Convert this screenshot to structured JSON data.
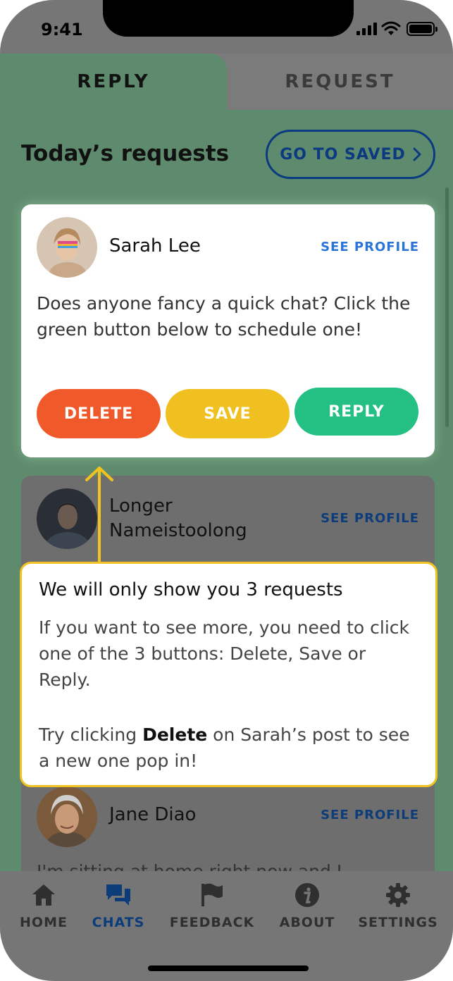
{
  "status_bar": {
    "time": "9:41"
  },
  "tabs": [
    {
      "label": "REPLY",
      "active": true
    },
    {
      "label": "REQUEST",
      "active": false
    }
  ],
  "header": {
    "title": "Today’s requests",
    "go_saved_label": "GO TO SAVED"
  },
  "cards": [
    {
      "name": "Sarah Lee",
      "see_profile": "SEE PROFILE",
      "body": "Does anyone fancy a quick chat? Click the green button below to schedule one!",
      "buttons": {
        "delete": "DELETE",
        "save": "SAVE",
        "reply": "REPLY"
      }
    },
    {
      "name_line1": "Longer",
      "name_line2": "Nameistoolong",
      "see_profile": "SEE PROFILE"
    },
    {
      "name": "Jane Diao",
      "see_profile": "SEE PROFILE",
      "body_partial": "I'm sitting at home right now and I"
    }
  ],
  "tooltip": {
    "title": "We will only show you 3 requests",
    "para1": "If you want to see more, you need to click one of the 3 buttons: Delete, Save or Reply.",
    "para2_before": "Try clicking ",
    "para2_bold": "Delete",
    "para2_after": " on Sarah’s post to see a new one pop in!"
  },
  "nav": [
    {
      "label": "HOME",
      "icon": "home-icon",
      "active": false
    },
    {
      "label": "CHATS",
      "icon": "chats-icon",
      "active": true
    },
    {
      "label": "FEEDBACK",
      "icon": "flag-icon",
      "active": false
    },
    {
      "label": "ABOUT",
      "icon": "info-icon",
      "active": false
    },
    {
      "label": "SETTINGS",
      "icon": "gear-icon",
      "active": false
    }
  ],
  "colors": {
    "accent_green": "#24c083",
    "delete_orange": "#f05a2a",
    "save_yellow": "#f0c020",
    "link_blue": "#2a73d9",
    "tooltip_border": "#f2c221"
  }
}
